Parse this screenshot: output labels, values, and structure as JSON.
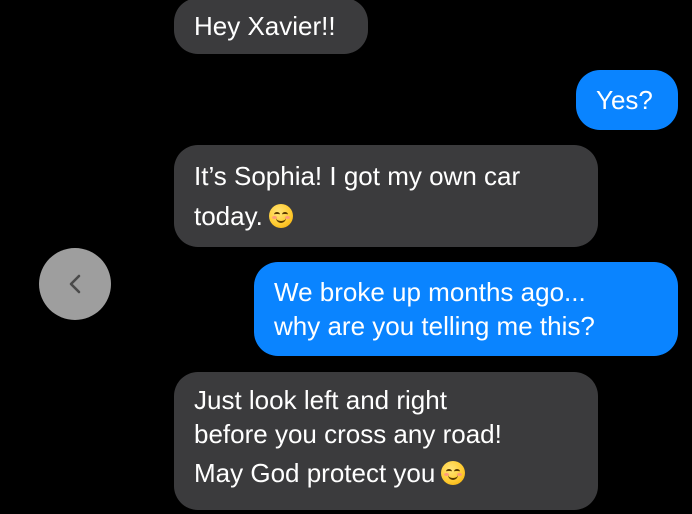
{
  "conversation": {
    "messages": [
      {
        "sender": "incoming",
        "lines": [
          "Hey Xavier!!"
        ]
      },
      {
        "sender": "outgoing",
        "lines": [
          "Yes?"
        ]
      },
      {
        "sender": "incoming",
        "lines": [
          "It’s Sophia! I got my own car",
          "today."
        ],
        "emoji": "smiling-face-emoji"
      },
      {
        "sender": "outgoing",
        "lines": [
          "We broke up months ago...",
          "why are you telling me this?"
        ]
      },
      {
        "sender": "incoming",
        "lines": [
          "Just look left and right",
          "before you cross any road!",
          "May God protect you"
        ],
        "emoji": "smiling-face-emoji"
      }
    ]
  },
  "controls": {
    "back_icon": "chevron-left-icon"
  },
  "colors": {
    "background": "#000000",
    "incoming_bubble": "#3b3b3d",
    "outgoing_bubble": "#0a84ff",
    "text": "#ffffff",
    "back_button": "#9e9e9e"
  }
}
